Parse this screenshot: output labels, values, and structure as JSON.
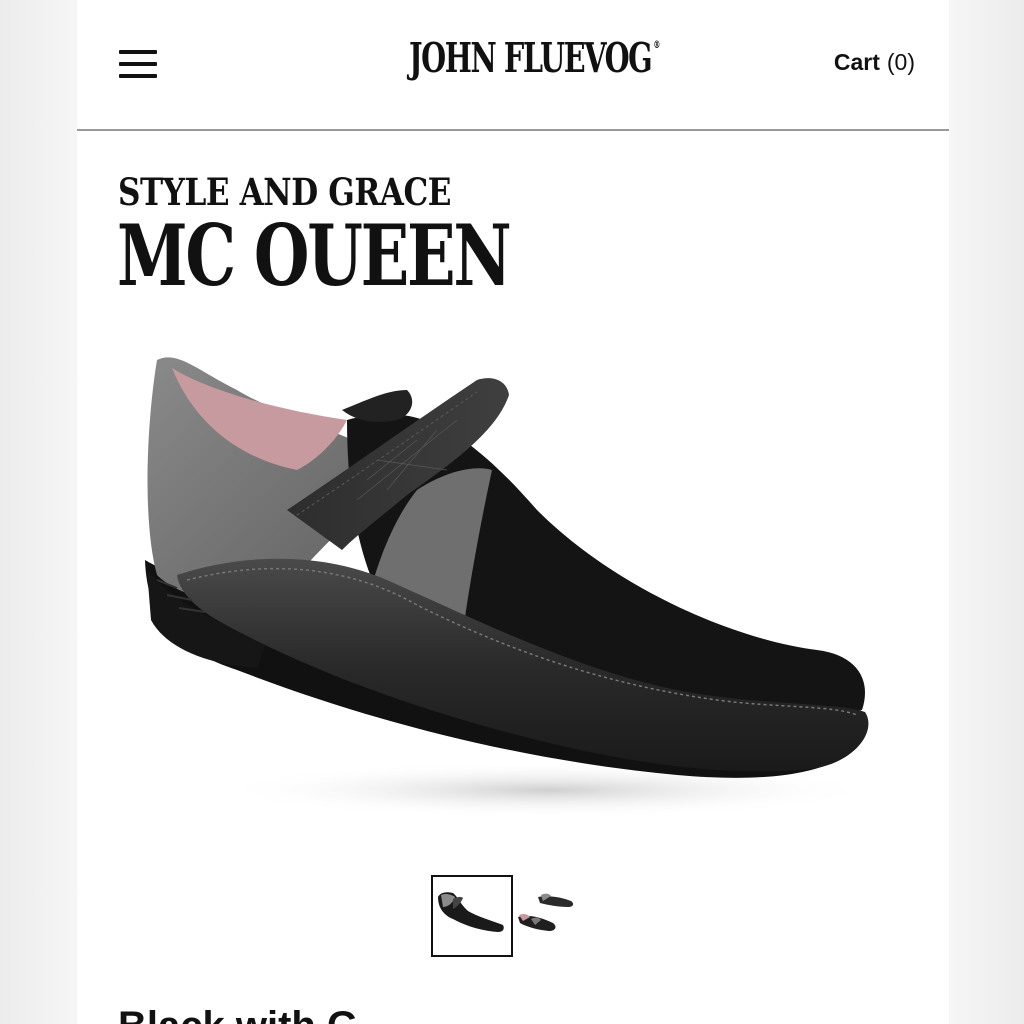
{
  "header": {
    "logo_text": "JOHN FLUEVOG",
    "logo_mark": "®",
    "menu_icon": "hamburger-menu-icon",
    "cart_label": "Cart",
    "cart_count": "(0)"
  },
  "product": {
    "collection": "STYLE AND GRACE",
    "name": "MC OUEEN",
    "image": "black-and-grey-monk-strap-shoe",
    "thumbnails": [
      {
        "image": "shoe-side-view",
        "selected": true
      },
      {
        "image": "shoe-pair-view",
        "selected": false
      }
    ]
  },
  "below_fold": {
    "partial_heading": "Black with G"
  }
}
